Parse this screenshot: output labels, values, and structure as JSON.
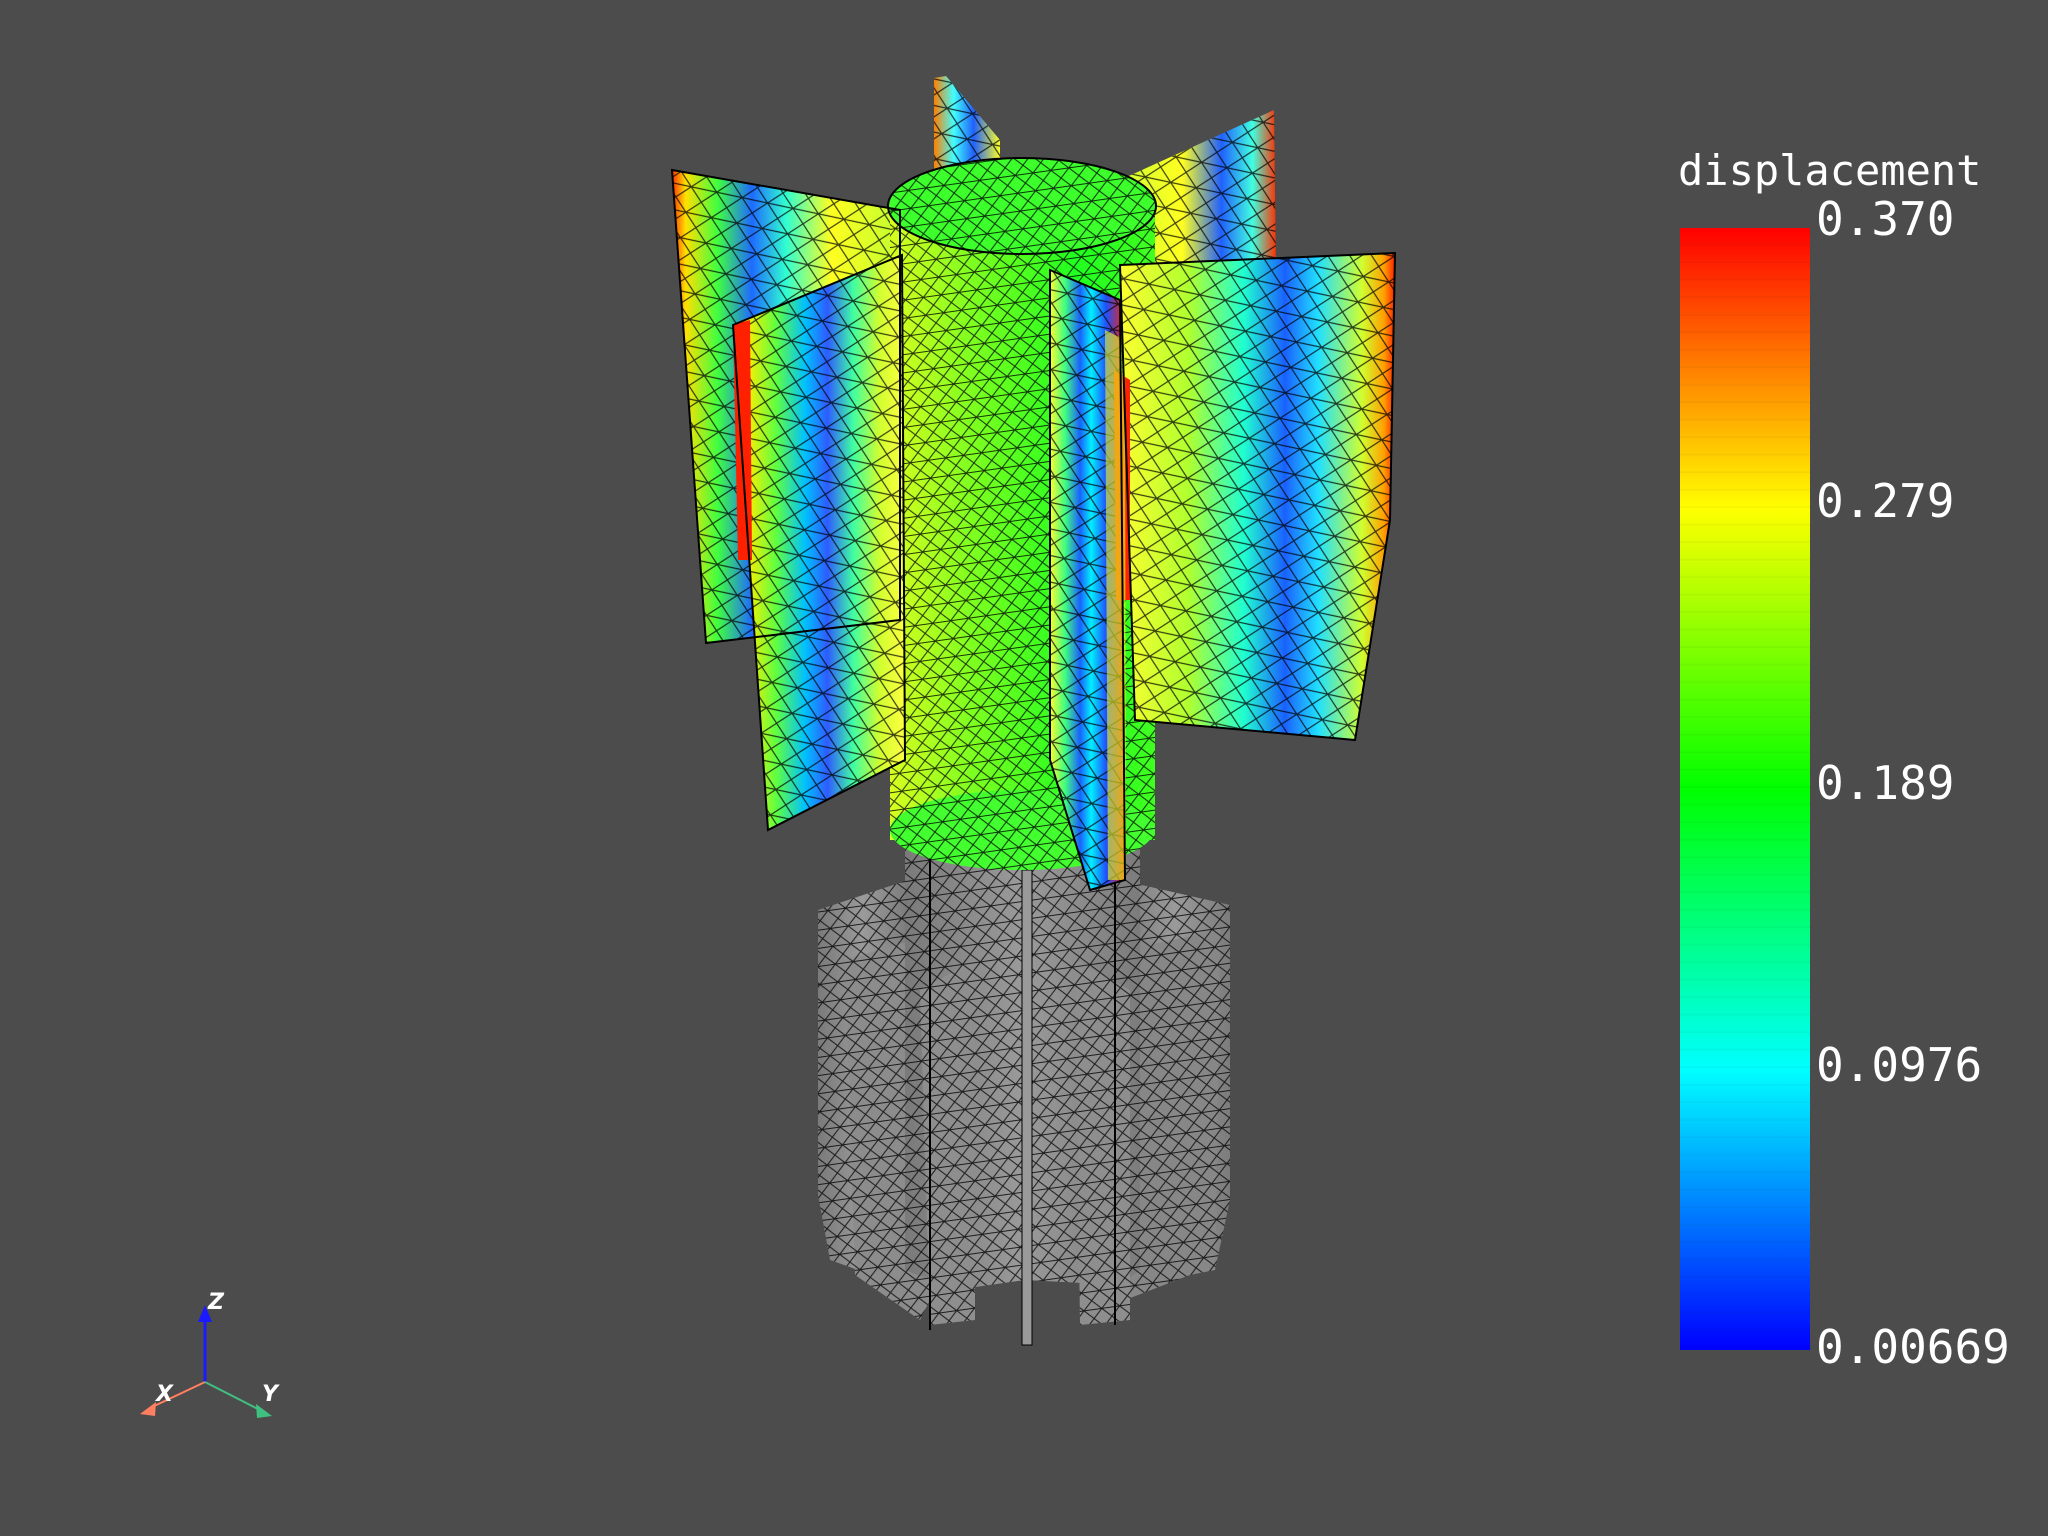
{
  "scalar_bar": {
    "title": "displacement",
    "ticks": [
      "0.370",
      "0.279",
      "0.189",
      "0.0976",
      "0.00669"
    ],
    "min": 0.00669,
    "max": 0.37,
    "colormap": [
      "#0000ff",
      "#00ffff",
      "#00ff00",
      "#ffff00",
      "#ff0000"
    ]
  },
  "axes_widget": {
    "z_label": "Z",
    "x_label": "X",
    "y_label": "Y",
    "z_color": "#1a1aff",
    "x_color": "#ff7f60",
    "y_color": "#40c080"
  },
  "scene": {
    "background": "#4c4c4c",
    "mesh_gray": "#8a8a8a",
    "edge_color": "#000000"
  }
}
